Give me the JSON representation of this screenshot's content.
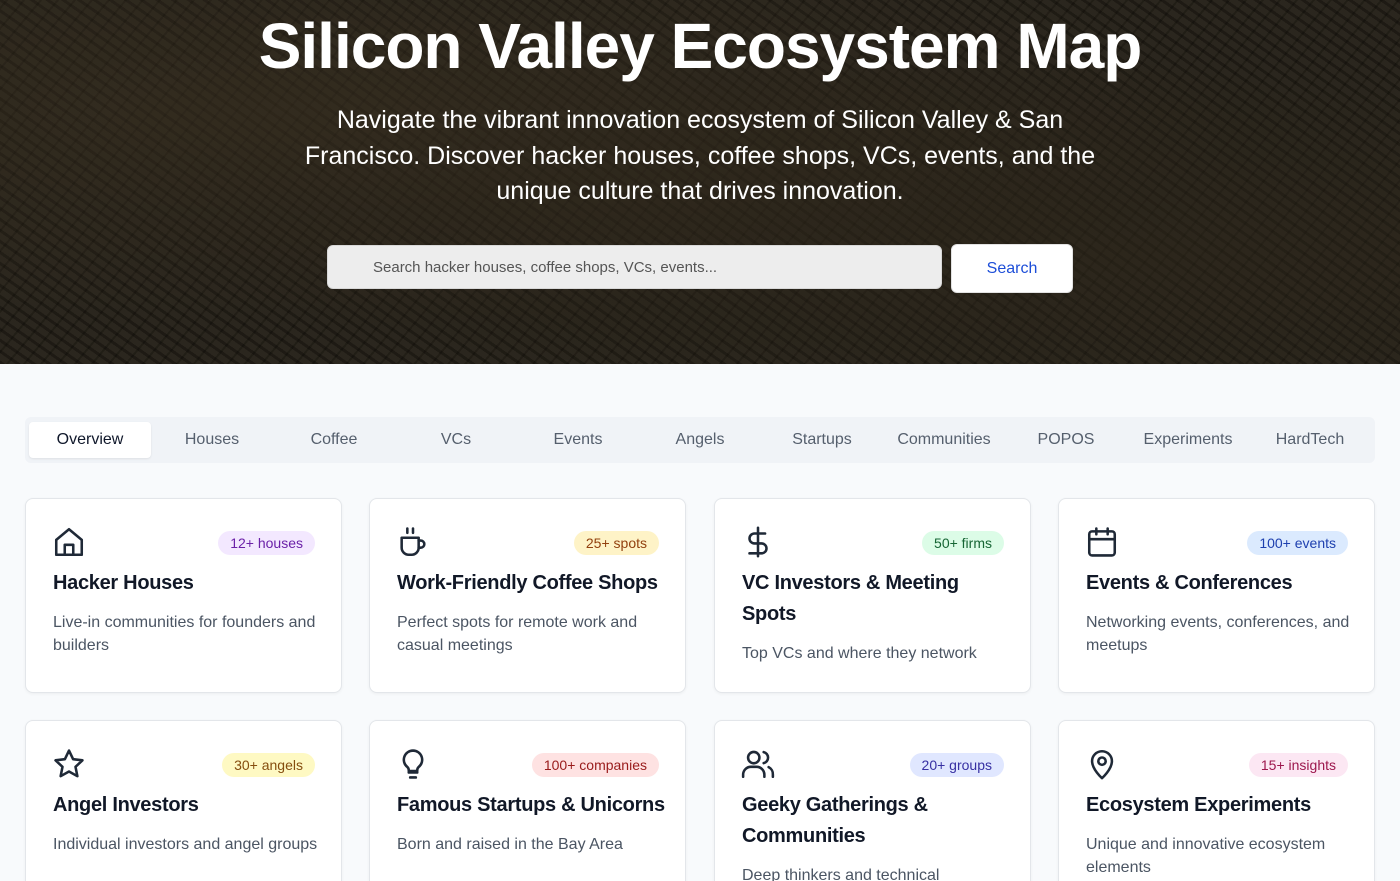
{
  "hero": {
    "title": "Silicon Valley Ecosystem Map",
    "subtitle": "Navigate the vibrant innovation ecosystem of Silicon Valley & San Francisco. Discover hacker houses, coffee shops, VCs, events, and the unique culture that drives innovation."
  },
  "search": {
    "placeholder": "Search hacker houses, coffee shops, VCs, events...",
    "button_label": "Search"
  },
  "tabs": [
    {
      "label": "Overview",
      "active": true
    },
    {
      "label": "Houses"
    },
    {
      "label": "Coffee"
    },
    {
      "label": "VCs"
    },
    {
      "label": "Events"
    },
    {
      "label": "Angels"
    },
    {
      "label": "Startups"
    },
    {
      "label": "Communities"
    },
    {
      "label": "POPOS"
    },
    {
      "label": "Experiments"
    },
    {
      "label": "HardTech"
    }
  ],
  "cards": [
    {
      "icon": "home-icon",
      "badge": "12+ houses",
      "badge_bg": "#f3e8ff",
      "badge_fg": "#6b21a8",
      "title": "Hacker Houses",
      "desc": "Live-in communities for founders and builders"
    },
    {
      "icon": "coffee-icon",
      "badge": "25+ spots",
      "badge_bg": "#fef3c7",
      "badge_fg": "#92400e",
      "title": "Work-Friendly Coffee Shops",
      "desc": "Perfect spots for remote work and casual meetings"
    },
    {
      "icon": "dollar-icon",
      "badge": "50+ firms",
      "badge_bg": "#dcfce7",
      "badge_fg": "#166534",
      "title": "VC Investors & Meeting Spots",
      "desc": "Top VCs and where they network"
    },
    {
      "icon": "calendar-icon",
      "badge": "100+ events",
      "badge_bg": "#dbeafe",
      "badge_fg": "#1e40af",
      "title": "Events & Conferences",
      "desc": "Networking events, conferences, and meetups"
    },
    {
      "icon": "star-icon",
      "badge": "30+ angels",
      "badge_bg": "#fef9c3",
      "badge_fg": "#854d0e",
      "title": "Angel Investors",
      "desc": "Individual investors and angel groups"
    },
    {
      "icon": "lightbulb-icon",
      "badge": "100+ companies",
      "badge_bg": "#fee2e2",
      "badge_fg": "#991b1b",
      "title": "Famous Startups & Unicorns",
      "desc": "Born and raised in the Bay Area"
    },
    {
      "icon": "users-icon",
      "badge": "20+ groups",
      "badge_bg": "#e0e7ff",
      "badge_fg": "#3730a3",
      "title": "Geeky Gatherings & Communities",
      "desc": "Deep thinkers and technical"
    },
    {
      "icon": "map-pin-icon",
      "badge": "15+ insights",
      "badge_bg": "#fce7f3",
      "badge_fg": "#9d174d",
      "title": "Ecosystem Experiments",
      "desc": "Unique and innovative ecosystem elements"
    }
  ]
}
